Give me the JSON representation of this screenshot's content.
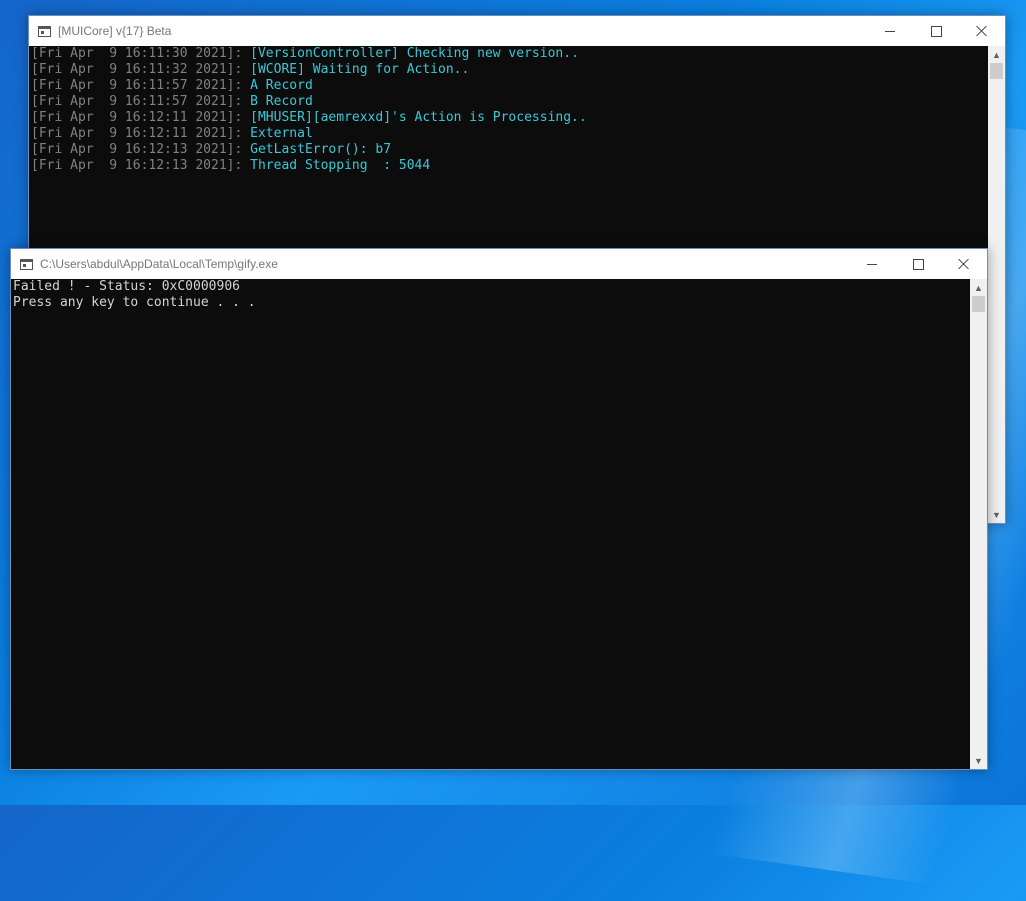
{
  "window_muicore": {
    "title": "[MUICore] v{17} Beta",
    "lines": [
      {
        "ts": "[Fri Apr  9 16:11:30 2021]:",
        "msg": " [VersionController] Checking new version.."
      },
      {
        "ts": "[Fri Apr  9 16:11:32 2021]:",
        "msg": " [WCORE] Waiting for Action.."
      },
      {
        "ts": "[Fri Apr  9 16:11:57 2021]:",
        "msg": " A Record"
      },
      {
        "ts": "[Fri Apr  9 16:11:57 2021]:",
        "msg": " B Record"
      },
      {
        "ts": "[Fri Apr  9 16:12:11 2021]:",
        "msg": " [MHUSER][aemrexxd]'s Action is Processing.."
      },
      {
        "ts": "[Fri Apr  9 16:12:11 2021]:",
        "msg": " External"
      },
      {
        "ts": "[Fri Apr  9 16:12:13 2021]:",
        "msg": " GetLastError(): b7"
      },
      {
        "ts": "[Fri Apr  9 16:12:13 2021]:",
        "msg": " Thread Stopping  : 5044"
      }
    ]
  },
  "window_gify": {
    "title": "C:\\Users\\abdul\\AppData\\Local\\Temp\\gify.exe",
    "lines": [
      "Failed ! - Status: 0xC0000906",
      "Press any key to continue . . ."
    ]
  },
  "icons": {
    "minimize": "minimize-icon",
    "maximize": "maximize-icon",
    "close": "close-icon",
    "console_app": "console-app-icon",
    "scroll_up": "▲",
    "scroll_down": "▼"
  },
  "colors": {
    "console_bg": "#0c0c0c",
    "timestamp": "#808080",
    "message": "#3ac8d6",
    "plain_text": "#d4d4d4"
  }
}
